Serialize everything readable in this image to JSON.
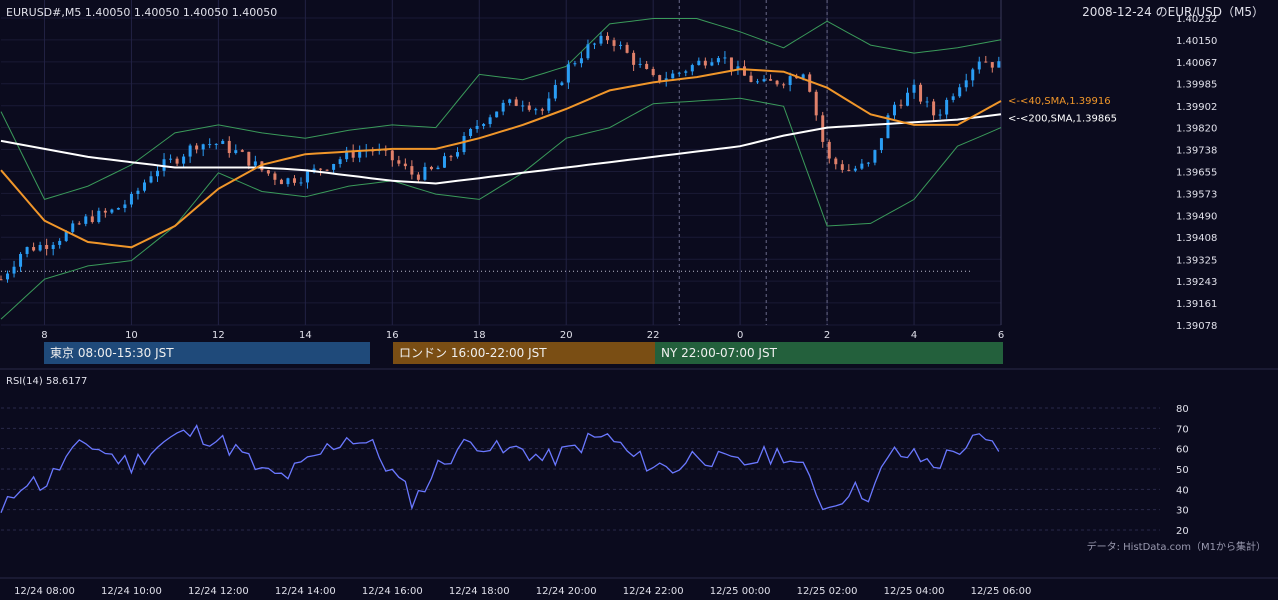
{
  "header": {
    "symbol_info": "EURUSD#,M5 1.40050 1.40050 1.40050 1.40050",
    "chart_title": "2008-12-24 のEUR/USD（M5）"
  },
  "sessions": [
    {
      "label": "東京 08:00-15:30 JST",
      "color": "#1f4a7a"
    },
    {
      "label": "ロンドン 16:00-22:00 JST",
      "color": "#7a4e14"
    },
    {
      "label": "NY 22:00-07:00 JST",
      "color": "#23603c"
    }
  ],
  "rsi_panel": {
    "label": "RSI(14) 58.6177"
  },
  "credit": "データ: HistData.com（M1から集計）",
  "colors": {
    "background": "#0b0b1e",
    "up_candle": "#2a9df4",
    "down_candle": "#e0806a",
    "sma40": "#f0962a",
    "sma200": "#ffffff",
    "bollinger": "#3a9a5a",
    "rsi_line": "#6a78ff"
  },
  "chart_data": [
    {
      "type": "candlestick",
      "title": "2008-12-24 のEUR/USD（M5）",
      "ylim": [
        1.39078,
        1.40232
      ],
      "y_ticks": [
        "1.40232",
        "1.40150",
        "1.40067",
        "1.39985",
        "1.39902",
        "1.39820",
        "1.39738",
        "1.39655",
        "1.39573",
        "1.39490",
        "1.39408",
        "1.39325",
        "1.39243",
        "1.39161",
        "1.39078"
      ],
      "x_ticks": [
        "8",
        "10",
        "12",
        "14",
        "16",
        "18",
        "20",
        "22",
        "0",
        "2",
        "4",
        "6"
      ],
      "x_tick_hours": [
        8,
        10,
        12,
        14,
        16,
        18,
        20,
        22,
        24,
        26,
        28,
        30
      ],
      "x_range_hours": [
        7.0,
        30.0
      ],
      "dotted_hline": 1.3928,
      "session_lines_hours": [
        22.6,
        24.6,
        26.0
      ],
      "annotations": [
        {
          "text": "<-<40,SMA,1.39916",
          "value": 1.39916,
          "color": "#f0962a"
        },
        {
          "text": "<-<200,SMA,1.39865",
          "value": 1.39865,
          "color": "#ffffff"
        }
      ],
      "series": [
        {
          "name": "40,SMA",
          "hours": [
            7.0,
            8.0,
            9.0,
            10.0,
            11.0,
            12.0,
            13.0,
            14.0,
            15.0,
            16.0,
            17.0,
            18.0,
            19.0,
            20.0,
            21.0,
            22.0,
            23.0,
            24.0,
            25.0,
            26.0,
            27.0,
            28.0,
            29.0,
            30.0
          ],
          "values": [
            1.3966,
            1.3947,
            1.3939,
            1.3937,
            1.3945,
            1.3959,
            1.3968,
            1.3972,
            1.3973,
            1.3974,
            1.3974,
            1.3978,
            1.3983,
            1.3989,
            1.3996,
            1.3999,
            1.4001,
            1.4004,
            1.4003,
            1.3997,
            1.3987,
            1.3983,
            1.3983,
            1.3992
          ]
        },
        {
          "name": "200,SMA",
          "hours": [
            7.0,
            8.0,
            9.0,
            10.0,
            11.0,
            12.0,
            13.0,
            14.0,
            15.0,
            16.0,
            17.0,
            18.0,
            19.0,
            20.0,
            21.0,
            22.0,
            23.0,
            24.0,
            25.0,
            26.0,
            27.0,
            28.0,
            29.0,
            30.0
          ],
          "values": [
            1.3977,
            1.3974,
            1.3971,
            1.3969,
            1.3967,
            1.3967,
            1.3967,
            1.3966,
            1.3964,
            1.3962,
            1.3961,
            1.3963,
            1.3965,
            1.3967,
            1.3969,
            1.3971,
            1.3973,
            1.3975,
            1.3979,
            1.3982,
            1.3983,
            1.3984,
            1.3985,
            1.3987
          ]
        },
        {
          "name": "BB upper",
          "hours": [
            7.0,
            8.0,
            9.0,
            10.0,
            11.0,
            12.0,
            13.0,
            14.0,
            15.0,
            16.0,
            17.0,
            18.0,
            19.0,
            20.0,
            21.0,
            22.0,
            23.0,
            24.0,
            25.0,
            26.0,
            27.0,
            28.0,
            29.0,
            30.0
          ],
          "values": [
            1.3988,
            1.3955,
            1.396,
            1.3968,
            1.398,
            1.3983,
            1.398,
            1.3978,
            1.3981,
            1.3983,
            1.3982,
            1.4002,
            1.4,
            1.4005,
            1.4021,
            1.4023,
            1.4023,
            1.4018,
            1.4012,
            1.4022,
            1.4013,
            1.401,
            1.4012,
            1.4015
          ]
        },
        {
          "name": "BB lower",
          "hours": [
            7.0,
            8.0,
            9.0,
            10.0,
            11.0,
            12.0,
            13.0,
            14.0,
            15.0,
            16.0,
            17.0,
            18.0,
            19.0,
            20.0,
            21.0,
            22.0,
            23.0,
            24.0,
            25.0,
            26.0,
            27.0,
            28.0,
            29.0,
            30.0
          ],
          "values": [
            1.391,
            1.3925,
            1.393,
            1.3932,
            1.3945,
            1.3965,
            1.3958,
            1.3956,
            1.396,
            1.3962,
            1.3957,
            1.3955,
            1.3965,
            1.3978,
            1.3982,
            1.3991,
            1.3992,
            1.3993,
            1.399,
            1.3945,
            1.3946,
            1.3955,
            1.3975,
            1.3982
          ]
        },
        {
          "name": "Close",
          "hours": [
            7.0,
            7.5,
            8.0,
            8.5,
            9.0,
            9.5,
            10.0,
            10.5,
            11.0,
            11.5,
            12.0,
            12.5,
            13.0,
            13.5,
            14.0,
            14.5,
            15.0,
            15.5,
            16.0,
            16.5,
            17.0,
            17.5,
            18.0,
            18.5,
            19.0,
            19.5,
            20.0,
            20.5,
            21.0,
            21.5,
            22.0,
            22.5,
            23.0,
            23.5,
            24.0,
            24.5,
            25.0,
            25.5,
            26.0,
            26.5,
            27.0,
            27.5,
            28.0,
            28.5,
            29.0,
            29.5,
            30.0
          ],
          "values": [
            1.3925,
            1.3936,
            1.3938,
            1.3942,
            1.3948,
            1.395,
            1.3955,
            1.3966,
            1.397,
            1.3976,
            1.3976,
            1.3972,
            1.3966,
            1.3962,
            1.3964,
            1.3968,
            1.3972,
            1.3974,
            1.397,
            1.3964,
            1.3966,
            1.3974,
            1.3984,
            1.399,
            1.3992,
            1.3988,
            1.4004,
            1.4012,
            1.4016,
            1.4008,
            1.4,
            1.4002,
            1.4006,
            1.401,
            1.4002,
            1.3998,
            1.4,
            1.4004,
            1.397,
            1.3966,
            1.3968,
            1.399,
            1.3996,
            1.3986,
            1.3998,
            1.4008,
            1.4005
          ]
        }
      ]
    },
    {
      "type": "line",
      "title": "RSI(14) 58.6177",
      "ylim": [
        20,
        80
      ],
      "y_ticks": [
        "80",
        "70",
        "60",
        "50",
        "40",
        "30",
        "20"
      ],
      "x_ticks": [
        "12/24 08:00",
        "12/24 10:00",
        "12/24 12:00",
        "12/24 14:00",
        "12/24 16:00",
        "12/24 18:00",
        "12/24 20:00",
        "12/24 22:00",
        "12/25 00:00",
        "12/25 02:00",
        "12/25 04:00",
        "12/25 06:00"
      ],
      "series": [
        {
          "name": "RSI(14)",
          "hours": [
            7.0,
            7.5,
            8.0,
            8.5,
            9.0,
            9.5,
            10.0,
            10.5,
            11.0,
            11.5,
            12.0,
            12.5,
            13.0,
            13.5,
            14.0,
            14.5,
            15.0,
            15.5,
            16.0,
            16.5,
            17.0,
            17.5,
            18.0,
            18.5,
            19.0,
            19.5,
            20.0,
            20.5,
            21.0,
            21.5,
            22.0,
            22.5,
            23.0,
            23.5,
            24.0,
            24.5,
            25.0,
            25.5,
            26.0,
            26.5,
            27.0,
            27.5,
            28.0,
            28.5,
            29.0,
            29.5,
            30.0
          ],
          "values": [
            27,
            45,
            42,
            55,
            63,
            57,
            52,
            60,
            66,
            68,
            64,
            58,
            48,
            46,
            52,
            60,
            66,
            62,
            48,
            34,
            50,
            60,
            64,
            58,
            60,
            54,
            58,
            64,
            66,
            56,
            52,
            50,
            58,
            54,
            52,
            56,
            58,
            48,
            30,
            40,
            38,
            58,
            56,
            52,
            60,
            64,
            58.6177
          ]
        }
      ]
    }
  ]
}
